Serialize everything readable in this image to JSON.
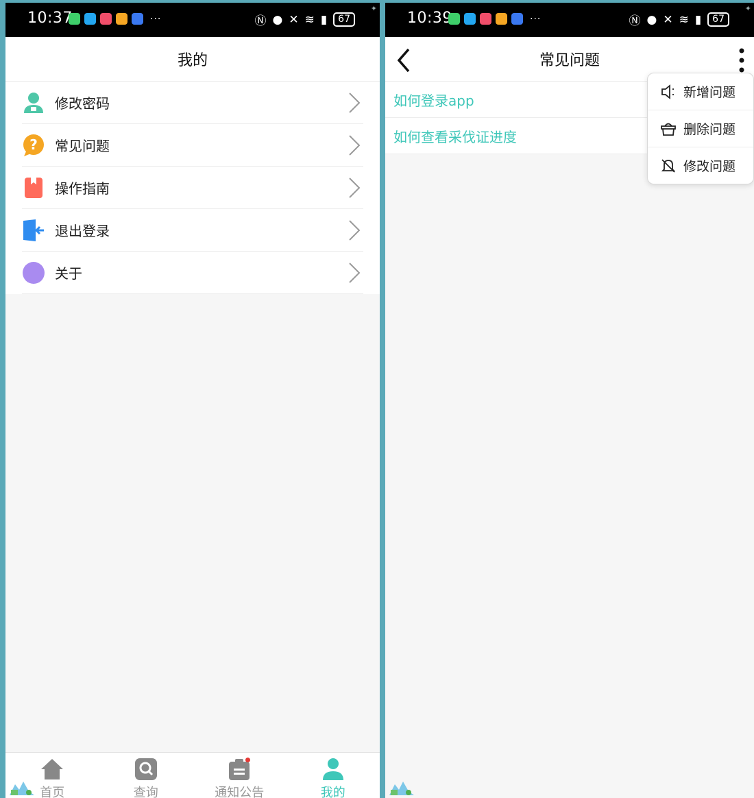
{
  "left_screen": {
    "status_bar": {
      "time": "10:37",
      "more": "···",
      "battery": "67"
    },
    "header": {
      "title": "我的"
    },
    "menu": [
      {
        "label": "修改密码",
        "icon": "user-lock-icon",
        "color": "#4fc7a8"
      },
      {
        "label": "常见问题",
        "icon": "question-bubble-icon",
        "color": "#f5a623"
      },
      {
        "label": "操作指南",
        "icon": "book-icon",
        "color": "#ff6b5b"
      },
      {
        "label": "退出登录",
        "icon": "logout-door-icon",
        "color": "#2f8cf0"
      },
      {
        "label": "关于",
        "icon": "info-circle-icon",
        "color": "#a98bf0"
      }
    ],
    "bottom_nav": [
      {
        "label": "首页",
        "icon": "home-icon",
        "active": false
      },
      {
        "label": "查询",
        "icon": "search-icon",
        "active": false
      },
      {
        "label": "通知公告",
        "icon": "notice-clipboard-icon",
        "active": false
      },
      {
        "label": "我的",
        "icon": "user-icon",
        "active": true
      }
    ]
  },
  "right_screen": {
    "status_bar": {
      "time": "10:39",
      "more": "···",
      "battery": "67"
    },
    "header": {
      "title": "常见问题"
    },
    "faq_items": [
      "如何登录app",
      "如何查看采伐证进度"
    ],
    "dropdown": [
      {
        "label": "新增问题",
        "icon": "speaker-icon"
      },
      {
        "label": "删除问题",
        "icon": "basket-icon"
      },
      {
        "label": "修改问题",
        "icon": "bell-off-icon"
      }
    ]
  },
  "colors": {
    "accent": "#3fc7b9",
    "status_bar": "#000000",
    "frame": "#5aa9b8"
  }
}
